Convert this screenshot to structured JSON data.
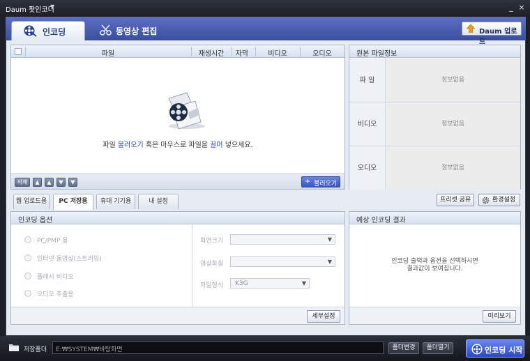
{
  "app": {
    "title": "Daum 팟인코더",
    "title_dropdown_glyph": "▼",
    "minimize_glyph": "_",
    "close_glyph": "×"
  },
  "main_tabs": [
    {
      "label": "인코딩",
      "active": true,
      "icon": "film-reel-icon"
    },
    {
      "label": "동영상 편집",
      "active": false,
      "icon": "scissors-icon"
    }
  ],
  "upload_button": {
    "label": "Daum 업로드",
    "icon": "upload-arrow-icon"
  },
  "file_list": {
    "columns": [
      "파일",
      "재생시간",
      "자막",
      "비디오",
      "오디오"
    ],
    "empty_hint_parts": [
      "파일 ",
      "불러오기",
      " 혹은 마우스로 파일을 ",
      "끌어",
      " 넣으세요."
    ],
    "delete_button": "삭제",
    "move_buttons": [
      "▲",
      "▲",
      "▼",
      "▼"
    ],
    "load_button": "불러오기",
    "load_plus": "+"
  },
  "source_info": {
    "title": "원본 파일정보",
    "rows": [
      {
        "key": "파  일",
        "value": "정보없음"
      },
      {
        "key": "비디오",
        "value": "정보없음"
      },
      {
        "key": "오디오",
        "value": "정보없음"
      }
    ]
  },
  "option_tabs": [
    {
      "label": "웹 업로드용",
      "active": false
    },
    {
      "label": "PC 저장용",
      "active": true
    },
    {
      "label": "휴대 기기용",
      "active": false
    },
    {
      "label": "내 설정",
      "active": false
    }
  ],
  "preset_share_button": "프리셋 공유",
  "settings_button": "환경설정",
  "encode_options": {
    "title": "인코딩 옵션",
    "radios": [
      "PC/PMP 용",
      "인터넷 동영상(스트리밍)",
      "플래시 비디오",
      "오디오 추출용"
    ],
    "fields": [
      {
        "label": "화면크기",
        "value": ""
      },
      {
        "label": "영상화질",
        "value": ""
      },
      {
        "label": "파일형식",
        "value": "K3G"
      }
    ],
    "detail_button": "세부설정"
  },
  "expected_result": {
    "title": "예상 인코딩 결과",
    "message_line1": "인코딩 출력과 옵션을 선택하시면",
    "message_line2": "결과값이 보여집니다.",
    "preview_button": "미리보기"
  },
  "bottom": {
    "folder_label": "저장폴더",
    "folder_path": "E:₩SYSTEM₩바탕화면",
    "change_folder_button": "폴더변경",
    "open_folder_button": "폴더열기",
    "start_button": "인코딩 시작"
  }
}
